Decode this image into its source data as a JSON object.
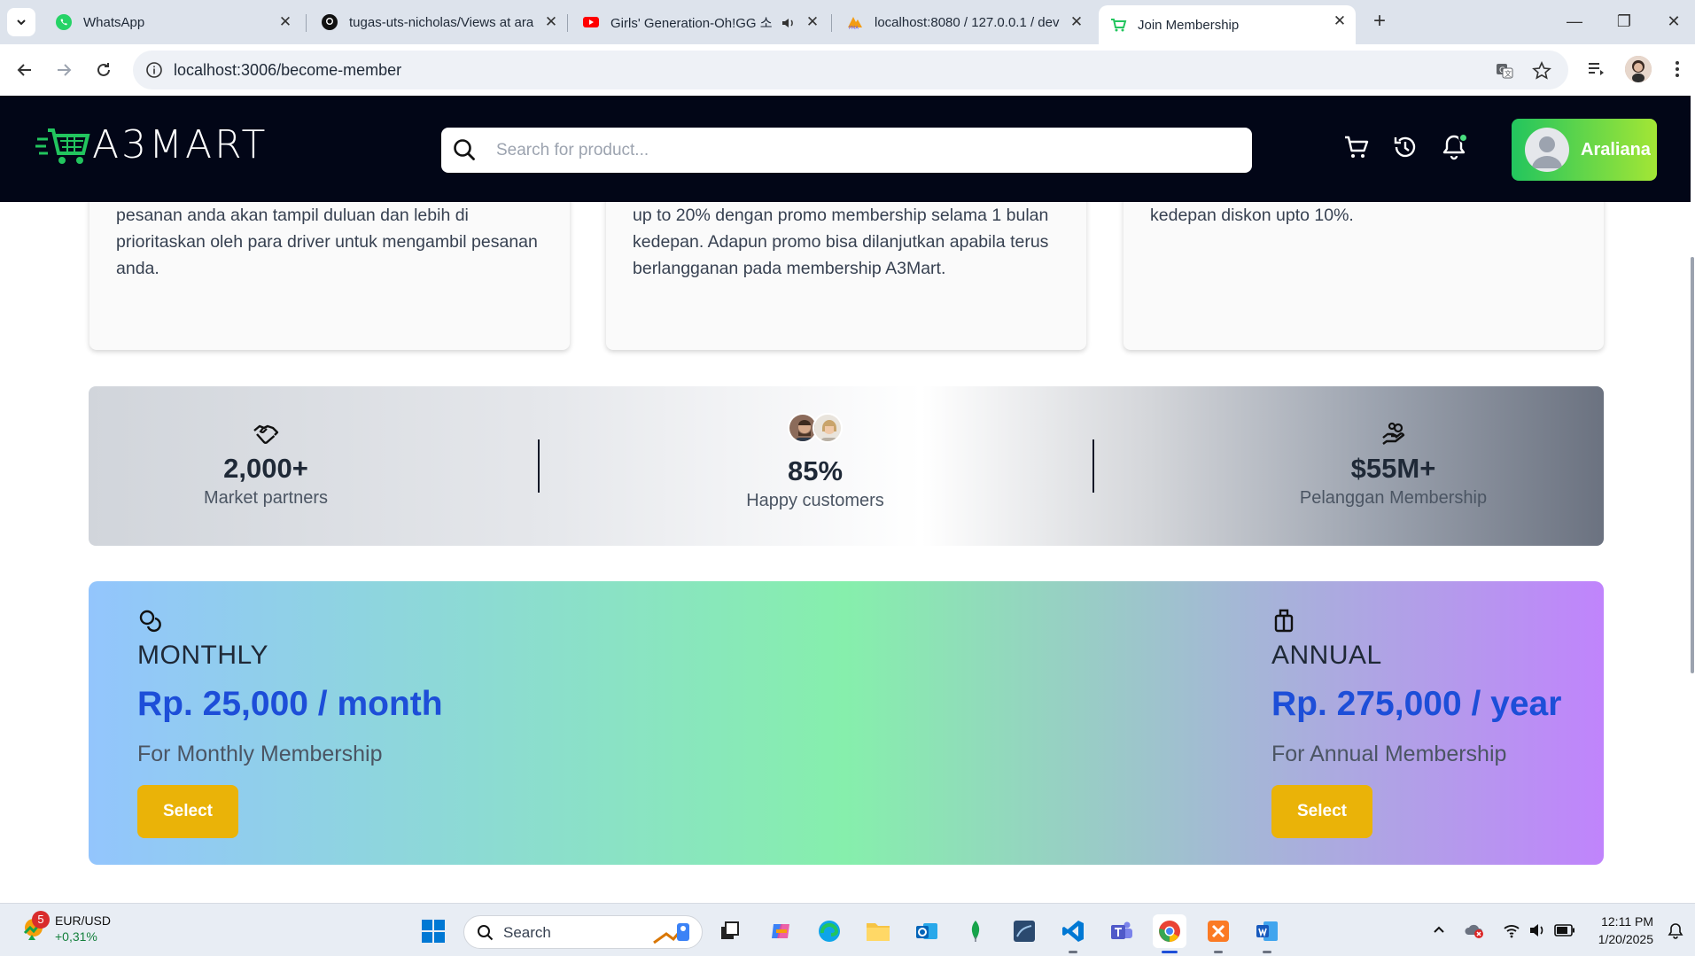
{
  "browser": {
    "tabs": [
      {
        "title": "WhatsApp",
        "icon": "whatsapp-icon"
      },
      {
        "title": "tugas-uts-nicholas/Views at ara",
        "icon": "github-icon"
      },
      {
        "title": "Girls' Generation-Oh!GG 소",
        "icon": "youtube-icon"
      },
      {
        "title": "localhost:8080 / 127.0.0.1 / dev",
        "icon": "phpmyadmin-icon"
      },
      {
        "title": "Join Membership",
        "icon": "cart-favicon"
      }
    ],
    "url": "localhost:3006/become-member"
  },
  "header": {
    "logo_text": "A3MART",
    "search_placeholder": "Search for product...",
    "user_name": "Araliana"
  },
  "features": [
    {
      "text": "pesanan anda akan tampil duluan dan lebih di prioritaskan oleh para driver untuk mengambil pesanan anda."
    },
    {
      "text": "up to 20% dengan promo membership selama 1 bulan kedepan. Adapun promo bisa dilanjutkan apabila terus berlangganan pada membership A3Mart."
    },
    {
      "text": "kedepan diskon upto 10%."
    }
  ],
  "stats": [
    {
      "value": "2,000+",
      "label": "Market partners",
      "icon": "handshake-icon"
    },
    {
      "value": "85%",
      "label": "Happy customers",
      "icon": "customer-avatars"
    },
    {
      "value": "$55M+",
      "label": "Pelanggan Membership",
      "icon": "hand-coins-icon"
    }
  ],
  "plans": {
    "monthly": {
      "title": "MONTHLY",
      "price": "Rp. 25,000 / month",
      "desc": "For Monthly Membership",
      "button": "Select",
      "icon": "coins-icon"
    },
    "annual": {
      "title": "ANNUAL",
      "price": "Rp. 275,000 / year",
      "desc": "For Annual Membership",
      "button": "Select",
      "icon": "luggage-icon"
    }
  },
  "taskbar": {
    "ticker_badge": "5",
    "ticker_symbol": "EUR/USD",
    "ticker_change": "+0,31%",
    "search_label": "Search",
    "time": "12:11 PM",
    "date": "1/20/2025"
  },
  "colors": {
    "header_bg": "#020617",
    "accent_green": "#22c55e",
    "price_blue": "#1d4ed8",
    "select_yellow": "#eab308"
  }
}
